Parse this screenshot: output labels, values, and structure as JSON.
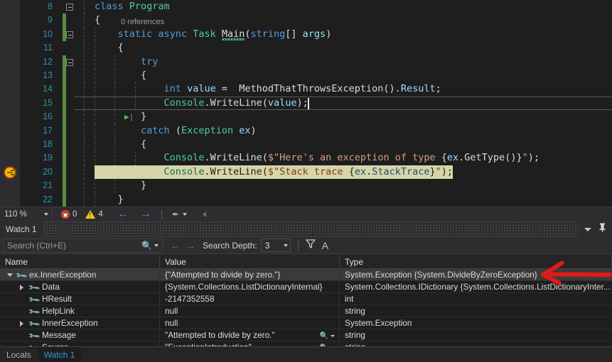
{
  "editor": {
    "language": "csharp",
    "zoom_level": "110 %",
    "lines": [
      {
        "num": "8",
        "indent": 0,
        "changed": false,
        "collapse": true,
        "guides": 1,
        "segments": [
          {
            "t": "class ",
            "c": "kw"
          },
          {
            "t": "Program",
            "c": "type"
          }
        ]
      },
      {
        "num": "9",
        "indent": 0,
        "changed": true,
        "collapse": false,
        "guides": 1,
        "segments": [
          {
            "t": "{",
            "c": "pln"
          }
        ]
      },
      {
        "num": "10",
        "indent": 0,
        "changed": true,
        "collapse": true,
        "guides": 2,
        "codelens": "0 references",
        "segments": [
          {
            "t": "    ",
            "c": "pln"
          },
          {
            "t": "static ",
            "c": "kw"
          },
          {
            "t": "async ",
            "c": "kw"
          },
          {
            "t": "Task ",
            "c": "type"
          },
          {
            "t": "Main",
            "c": "meth",
            "squiggle": true
          },
          {
            "t": "(",
            "c": "pln"
          },
          {
            "t": "string",
            "c": "kw"
          },
          {
            "t": "[] ",
            "c": "pln"
          },
          {
            "t": "args",
            "c": "ident"
          },
          {
            "t": ")",
            "c": "pln"
          }
        ]
      },
      {
        "num": "11",
        "indent": 0,
        "changed": false,
        "collapse": false,
        "guides": 2,
        "segments": [
          {
            "t": "    {",
            "c": "pln"
          }
        ]
      },
      {
        "num": "12",
        "indent": 0,
        "changed": true,
        "collapse": true,
        "guides": 3,
        "segments": [
          {
            "t": "        ",
            "c": "pln"
          },
          {
            "t": "try",
            "c": "kw"
          }
        ]
      },
      {
        "num": "13",
        "indent": 0,
        "changed": true,
        "collapse": false,
        "guides": 3,
        "segments": [
          {
            "t": "        {",
            "c": "pln"
          }
        ]
      },
      {
        "num": "14",
        "indent": 0,
        "changed": true,
        "collapse": false,
        "guides": 4,
        "segments": [
          {
            "t": "            ",
            "c": "pln"
          },
          {
            "t": "int ",
            "c": "kw"
          },
          {
            "t": "value",
            "c": "ident"
          },
          {
            "t": " =  ",
            "c": "pln"
          },
          {
            "t": "MethodThatThrowsException",
            "c": "meth"
          },
          {
            "t": "().",
            "c": "pln"
          },
          {
            "t": "Result",
            "c": "ident"
          },
          {
            "t": ";",
            "c": "pln"
          }
        ]
      },
      {
        "num": "15",
        "indent": 0,
        "changed": true,
        "collapse": false,
        "guides": 4,
        "current_line": true,
        "caret": true,
        "segments": [
          {
            "t": "            ",
            "c": "pln"
          },
          {
            "t": "Console",
            "c": "type"
          },
          {
            "t": ".",
            "c": "pln"
          },
          {
            "t": "WriteLine",
            "c": "meth"
          },
          {
            "t": "(",
            "c": "pln"
          },
          {
            "t": "value",
            "c": "ident"
          },
          {
            "t": ");",
            "c": "pln"
          }
        ]
      },
      {
        "num": "16",
        "indent": 0,
        "changed": true,
        "collapse": false,
        "guides": 3,
        "step_arrow": true,
        "segments": [
          {
            "t": "        }",
            "c": "pln"
          }
        ]
      },
      {
        "num": "17",
        "indent": 0,
        "changed": true,
        "collapse": false,
        "guides": 3,
        "segments": [
          {
            "t": "        ",
            "c": "pln"
          },
          {
            "t": "catch ",
            "c": "kw"
          },
          {
            "t": "(",
            "c": "pln"
          },
          {
            "t": "Exception",
            "c": "type"
          },
          {
            "t": " ",
            "c": "pln"
          },
          {
            "t": "ex",
            "c": "ident"
          },
          {
            "t": ")",
            "c": "pln"
          }
        ]
      },
      {
        "num": "18",
        "indent": 0,
        "changed": true,
        "collapse": false,
        "guides": 3,
        "segments": [
          {
            "t": "        {",
            "c": "pln"
          }
        ]
      },
      {
        "num": "19",
        "indent": 0,
        "changed": true,
        "collapse": false,
        "guides": 4,
        "segments": [
          {
            "t": "            ",
            "c": "pln"
          },
          {
            "t": "Console",
            "c": "type"
          },
          {
            "t": ".",
            "c": "pln"
          },
          {
            "t": "WriteLine",
            "c": "meth"
          },
          {
            "t": "(",
            "c": "pln"
          },
          {
            "t": "$\"Here's an exception of type ",
            "c": "str"
          },
          {
            "t": "{",
            "c": "pln"
          },
          {
            "t": "ex",
            "c": "ident"
          },
          {
            "t": ".",
            "c": "pln"
          },
          {
            "t": "GetType",
            "c": "meth"
          },
          {
            "t": "()",
            "c": "pln"
          },
          {
            "t": "}",
            "c": "pln"
          },
          {
            "t": "\"",
            "c": "str"
          },
          {
            "t": ");",
            "c": "pln"
          }
        ]
      },
      {
        "num": "20",
        "indent": 0,
        "changed": true,
        "collapse": false,
        "guides": 4,
        "exec_point": true,
        "highlight": true,
        "segments": [
          {
            "t": "            ",
            "c": "pln"
          },
          {
            "t": "Console",
            "c": "type"
          },
          {
            "t": ".",
            "c": "pln"
          },
          {
            "t": "WriteLine",
            "c": "meth"
          },
          {
            "t": "(",
            "c": "pln"
          },
          {
            "t": "$\"Stack trace ",
            "c": "str"
          },
          {
            "t": "{",
            "c": "pln"
          },
          {
            "t": "ex",
            "c": "ident"
          },
          {
            "t": ".",
            "c": "pln"
          },
          {
            "t": "StackTrace",
            "c": "ident"
          },
          {
            "t": "}",
            "c": "pln"
          },
          {
            "t": "\"",
            "c": "str"
          },
          {
            "t": ");",
            "c": "pln"
          }
        ]
      },
      {
        "num": "21",
        "indent": 0,
        "changed": true,
        "collapse": false,
        "guides": 3,
        "segments": [
          {
            "t": "        }",
            "c": "pln"
          }
        ]
      },
      {
        "num": "22",
        "indent": 0,
        "changed": true,
        "collapse": false,
        "guides": 2,
        "segments": [
          {
            "t": "    }",
            "c": "pln"
          }
        ]
      }
    ]
  },
  "status_bar": {
    "zoom": "110 %",
    "error_count": "0",
    "warning_count": "4",
    "prev_label": "←",
    "next_label": "→",
    "brush_label": "✒"
  },
  "watch": {
    "title": "Watch 1",
    "search": {
      "placeholder": "Search (Ctrl+E)",
      "value": ""
    },
    "search_depth_label": "Search Depth:",
    "search_depth_value": "3",
    "columns": [
      "Name",
      "Value",
      "Type"
    ],
    "rows": [
      {
        "name": "ex.InnerException",
        "value": "{\"Attempted to divide by zero.\"}",
        "type": "System.Exception {System.DivideByZeroException}",
        "depth": 0,
        "expander": "open",
        "selected": true,
        "magnifier": false
      },
      {
        "name": "Data",
        "value": "{System.Collections.ListDictionaryInternal}",
        "type": "System.Collections.IDictionary {System.Collections.ListDictionaryInter...",
        "depth": 1,
        "expander": "closed",
        "selected": false,
        "magnifier": false
      },
      {
        "name": "HResult",
        "value": "-2147352558",
        "type": "int",
        "depth": 1,
        "expander": "none",
        "selected": false,
        "magnifier": false
      },
      {
        "name": "HelpLink",
        "value": "null",
        "type": "string",
        "depth": 1,
        "expander": "none",
        "selected": false,
        "magnifier": false
      },
      {
        "name": "InnerException",
        "value": "null",
        "type": "System.Exception",
        "depth": 1,
        "expander": "closed",
        "selected": false,
        "magnifier": false
      },
      {
        "name": "Message",
        "value": "\"Attempted to divide by zero.\"",
        "type": "string",
        "depth": 1,
        "expander": "none",
        "selected": false,
        "magnifier": true
      },
      {
        "name": "Source",
        "value": "\"ExceptionIntroduction\"",
        "type": "string",
        "depth": 1,
        "expander": "none",
        "selected": false,
        "magnifier": true
      }
    ],
    "tabs": [
      {
        "label": "Locals",
        "active": false
      },
      {
        "label": "Watch 1",
        "active": true
      }
    ]
  },
  "annotation": {
    "arrow_color": "#e01b17",
    "points_at": "System.Exception {System.DivideByZeroException}"
  }
}
